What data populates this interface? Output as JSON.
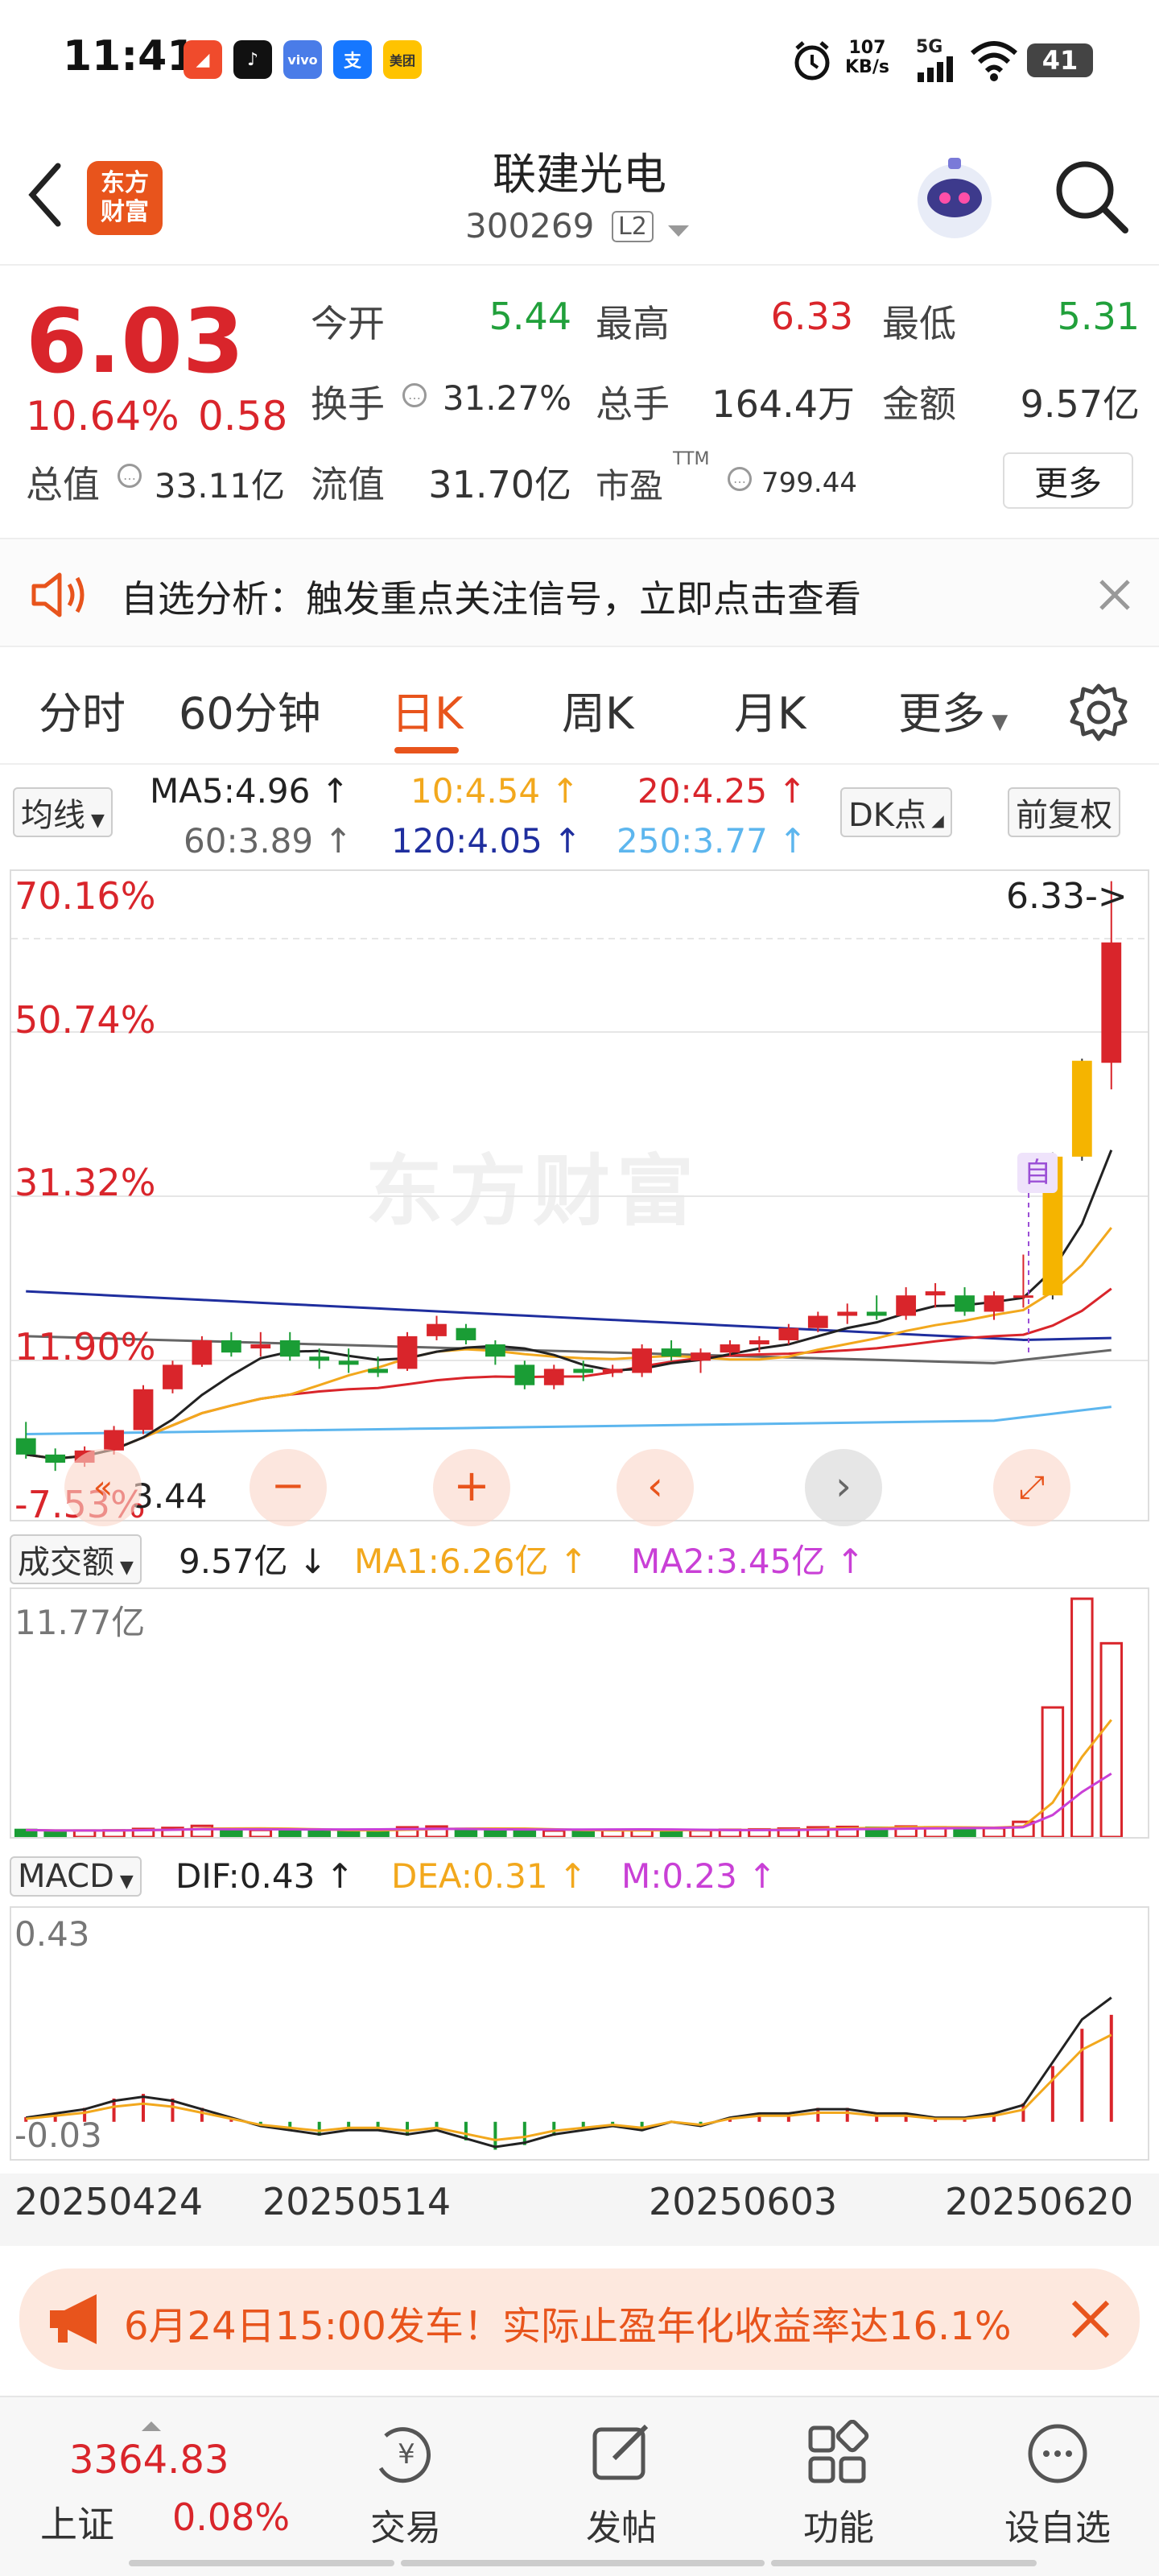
{
  "status_bar": {
    "time": "11:41",
    "net_speed_value": "107",
    "net_speed_unit": "KB/s",
    "signal": "5G",
    "battery": "41",
    "apps": [
      {
        "name": "reader-app-icon",
        "label": "",
        "color": "#f04b2c"
      },
      {
        "name": "tiktok-app-icon",
        "label": "",
        "color": "#111111"
      },
      {
        "name": "vivo-app-icon",
        "label": "vivo",
        "color": "#4a7ce8"
      },
      {
        "name": "alipay-app-icon",
        "label": "支",
        "color": "#1677ff"
      },
      {
        "name": "meituan-app-icon",
        "label": "美团",
        "color": "#ffc300"
      }
    ]
  },
  "header": {
    "logo_text": "东方\n财富",
    "stock_name": "联建光电",
    "stock_code": "300269",
    "badge": "L2"
  },
  "quote": {
    "price": "6.03",
    "change_pct": "10.64%",
    "change_amt": "0.58",
    "fields": {
      "open_label": "今开",
      "open": "5.44",
      "high_label": "最高",
      "high": "6.33",
      "low_label": "最低",
      "low": "5.31",
      "turnover_label": "换手",
      "turnover": "31.27%",
      "volume_label": "总手",
      "volume": "164.4万",
      "amount_label": "金额",
      "amount": "9.57亿",
      "mktcap_label": "总值",
      "mktcap": "33.11亿",
      "float_label": "流值",
      "float": "31.70亿",
      "pe_label": "市盈",
      "pe_sup": "TTM",
      "pe": "799.44"
    },
    "more_label": "更多"
  },
  "notice": {
    "text": "自选分析：触发重点关注信号，立即点击查看"
  },
  "tabs": [
    {
      "label": "分时",
      "active": false
    },
    {
      "label": "60分钟",
      "active": false
    },
    {
      "label": "日K",
      "active": true
    },
    {
      "label": "周K",
      "active": false
    },
    {
      "label": "月K",
      "active": false
    },
    {
      "label": "更多",
      "active": false
    }
  ],
  "ma": {
    "selector": "均线",
    "ma5": "MA5:4.96",
    "ma10": "10:4.54",
    "ma20": "20:4.25",
    "ma60": "60:3.89",
    "ma120": "120:4.05",
    "ma250": "250:3.77",
    "dk_label": "DK点",
    "adjust_label": "前复权",
    "colors": {
      "ma5": "#222222",
      "ma10": "#f2a81d",
      "ma20": "#d9252b",
      "ma60": "#666666",
      "ma120": "#1f2e9e",
      "ma250": "#5db6ee"
    }
  },
  "kline": {
    "y_labels": [
      "70.16%",
      "50.74%",
      "31.32%",
      "11.90%",
      "-7.53%"
    ],
    "high_marker": "6.33->",
    "low_marker": "3.44",
    "watermark": "东方财富",
    "self_tag": "自",
    "candles": [
      {
        "o": 3.6,
        "h": 3.68,
        "l": 3.5,
        "c": 3.52
      },
      {
        "o": 3.52,
        "h": 3.55,
        "l": 3.44,
        "c": 3.48
      },
      {
        "o": 3.48,
        "h": 3.56,
        "l": 3.46,
        "c": 3.54
      },
      {
        "o": 3.54,
        "h": 3.66,
        "l": 3.52,
        "c": 3.64
      },
      {
        "o": 3.64,
        "h": 3.86,
        "l": 3.62,
        "c": 3.84
      },
      {
        "o": 3.84,
        "h": 3.98,
        "l": 3.82,
        "c": 3.96
      },
      {
        "o": 3.96,
        "h": 4.1,
        "l": 3.95,
        "c": 4.08
      },
      {
        "o": 4.08,
        "h": 4.12,
        "l": 4.0,
        "c": 4.02
      },
      {
        "o": 4.04,
        "h": 4.12,
        "l": 4.0,
        "c": 4.06
      },
      {
        "o": 4.08,
        "h": 4.12,
        "l": 3.98,
        "c": 4.0
      },
      {
        "o": 4.0,
        "h": 4.04,
        "l": 3.94,
        "c": 3.98
      },
      {
        "o": 3.98,
        "h": 4.04,
        "l": 3.92,
        "c": 3.96
      },
      {
        "o": 3.94,
        "h": 4.0,
        "l": 3.9,
        "c": 3.92
      },
      {
        "o": 3.94,
        "h": 4.12,
        "l": 3.93,
        "c": 4.1
      },
      {
        "o": 4.1,
        "h": 4.2,
        "l": 4.08,
        "c": 4.16
      },
      {
        "o": 4.14,
        "h": 4.16,
        "l": 4.06,
        "c": 4.08
      },
      {
        "o": 4.06,
        "h": 4.08,
        "l": 3.96,
        "c": 4.0
      },
      {
        "o": 3.96,
        "h": 3.98,
        "l": 3.84,
        "c": 3.86
      },
      {
        "o": 3.86,
        "h": 3.96,
        "l": 3.84,
        "c": 3.94
      },
      {
        "o": 3.94,
        "h": 3.98,
        "l": 3.88,
        "c": 3.92
      },
      {
        "o": 3.92,
        "h": 3.96,
        "l": 3.9,
        "c": 3.94
      },
      {
        "o": 3.92,
        "h": 4.06,
        "l": 3.9,
        "c": 4.04
      },
      {
        "o": 4.04,
        "h": 4.08,
        "l": 3.98,
        "c": 4.0
      },
      {
        "o": 3.98,
        "h": 4.04,
        "l": 3.92,
        "c": 4.02
      },
      {
        "o": 4.02,
        "h": 4.08,
        "l": 4.0,
        "c": 4.06
      },
      {
        "o": 4.06,
        "h": 4.1,
        "l": 4.02,
        "c": 4.08
      },
      {
        "o": 4.08,
        "h": 4.16,
        "l": 4.06,
        "c": 4.14
      },
      {
        "o": 4.14,
        "h": 4.22,
        "l": 4.12,
        "c": 4.2
      },
      {
        "o": 4.2,
        "h": 4.26,
        "l": 4.16,
        "c": 4.22
      },
      {
        "o": 4.22,
        "h": 4.3,
        "l": 4.18,
        "c": 4.2
      },
      {
        "o": 4.2,
        "h": 4.34,
        "l": 4.18,
        "c": 4.3
      },
      {
        "o": 4.3,
        "h": 4.36,
        "l": 4.24,
        "c": 4.32
      },
      {
        "o": 4.3,
        "h": 4.34,
        "l": 4.2,
        "c": 4.22
      },
      {
        "o": 4.22,
        "h": 4.32,
        "l": 4.18,
        "c": 4.3
      },
      {
        "o": 4.3,
        "h": 4.5,
        "l": 4.24,
        "c": 4.3
      },
      {
        "o": 4.3,
        "h": 5.0,
        "l": 4.28,
        "c": 4.98,
        "limit": true
      },
      {
        "o": 4.98,
        "h": 5.46,
        "l": 4.96,
        "c": 5.45,
        "limit": true
      },
      {
        "o": 5.44,
        "h": 6.33,
        "l": 5.31,
        "c": 6.03
      }
    ],
    "price_range": [
      3.2,
      6.38
    ]
  },
  "volume": {
    "selector": "成交额",
    "current": "9.57亿",
    "ma1": "MA1:6.26亿",
    "ma2": "MA2:3.45亿",
    "y_top": "11.77亿",
    "values": [
      0.35,
      0.3,
      0.32,
      0.33,
      0.4,
      0.45,
      0.55,
      0.38,
      0.35,
      0.33,
      0.3,
      0.32,
      0.35,
      0.48,
      0.52,
      0.4,
      0.36,
      0.33,
      0.3,
      0.32,
      0.34,
      0.36,
      0.34,
      0.33,
      0.36,
      0.38,
      0.42,
      0.48,
      0.5,
      0.46,
      0.52,
      0.48,
      0.42,
      0.44,
      0.75,
      6.4,
      11.77,
      9.57
    ],
    "max": 11.77
  },
  "macd": {
    "selector": "MACD",
    "dif": "DIF:0.43",
    "dea": "DEA:0.31",
    "m": "M:0.23",
    "y_top": "0.43",
    "y_bottom": "-0.03",
    "hist": [
      0.01,
      0.02,
      0.03,
      0.05,
      0.06,
      0.05,
      0.03,
      0.01,
      -0.01,
      -0.02,
      -0.03,
      -0.02,
      -0.02,
      -0.03,
      -0.02,
      -0.04,
      -0.06,
      -0.05,
      -0.03,
      -0.02,
      -0.01,
      -0.02,
      0.0,
      -0.01,
      0.01,
      0.02,
      0.02,
      0.03,
      0.03,
      0.02,
      0.02,
      0.01,
      0.01,
      0.02,
      0.04,
      0.12,
      0.2,
      0.23
    ],
    "range": [
      -0.08,
      0.46
    ]
  },
  "dates": [
    "20250424",
    "20250514",
    "20250603",
    "20250620"
  ],
  "ad": {
    "text": "6月24日15:00发车！实际止盈年化收益率达16.1%"
  },
  "bottom_nav": {
    "index_value": "3364.83",
    "index_name": "上证",
    "index_change": "0.08%",
    "items": [
      {
        "label": "交易",
        "icon": "trade-icon"
      },
      {
        "label": "发帖",
        "icon": "post-icon"
      },
      {
        "label": "功能",
        "icon": "function-icon"
      },
      {
        "label": "设自选",
        "icon": "add-watchlist-icon"
      }
    ]
  }
}
